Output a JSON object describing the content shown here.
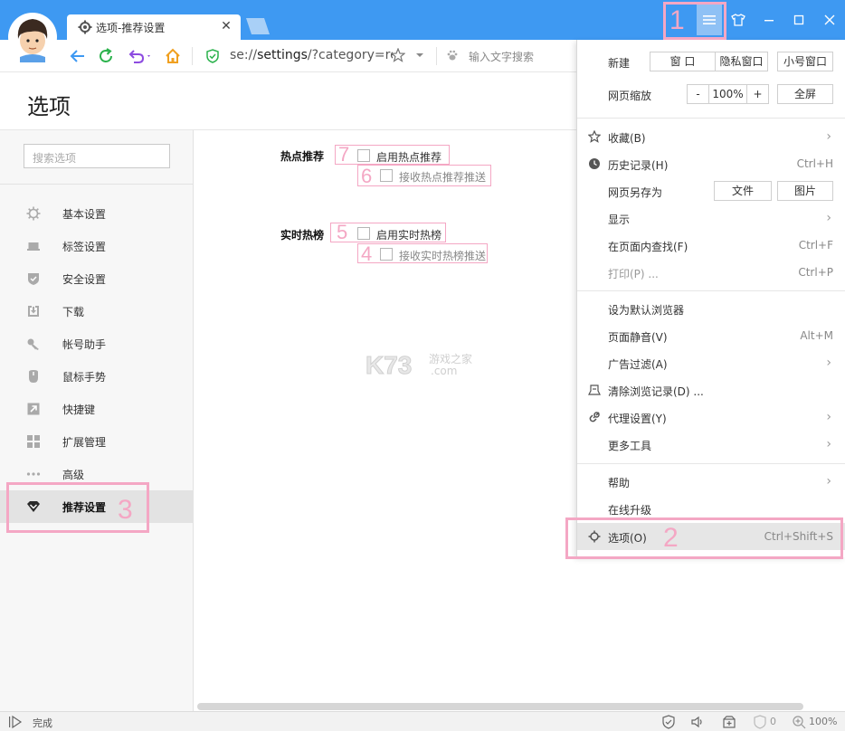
{
  "window": {
    "tab_title": "选项-推荐设置",
    "tab_close": "✕"
  },
  "address_bar": {
    "url_prefix": "se://",
    "url_host": "settings",
    "url_rest": "/?category=re",
    "search_placeholder": "输入文字搜索"
  },
  "options_page": {
    "title": "选项",
    "search_placeholder": "搜索选项"
  },
  "sidebar": {
    "items": [
      {
        "label": "基本设置",
        "icon": "gear-icon"
      },
      {
        "label": "标签设置",
        "icon": "tab-icon"
      },
      {
        "label": "安全设置",
        "icon": "shield-icon"
      },
      {
        "label": "下载",
        "icon": "download-icon"
      },
      {
        "label": "帐号助手",
        "icon": "key-icon"
      },
      {
        "label": "鼠标手势",
        "icon": "mouse-icon"
      },
      {
        "label": "快捷键",
        "icon": "shortcut-icon"
      },
      {
        "label": "扩展管理",
        "icon": "extensions-icon"
      },
      {
        "label": "高级",
        "icon": "more-dots-icon"
      },
      {
        "label": "推荐设置",
        "icon": "diamond-icon",
        "active": true
      }
    ]
  },
  "content": {
    "hot_section_label": "热点推荐",
    "hot_enable_label": "启用热点推荐",
    "hot_push_label": "接收热点推荐推送",
    "realtime_section_label": "实时热榜",
    "realtime_enable_label": "启用实时热榜",
    "realtime_push_label": "接收实时热榜推送",
    "watermark_main": "K73",
    "watermark_sub": "游戏之家",
    "watermark_domain": ".com"
  },
  "annotations": {
    "n1": "1",
    "n2": "2",
    "n3": "3",
    "n4": "4",
    "n5": "5",
    "n6": "6",
    "n7": "7"
  },
  "menu": {
    "new_label": "新建",
    "new_window": "窗 口",
    "new_private": "隐私窗口",
    "new_small": "小号窗口",
    "zoom_label": "网页缩放",
    "zoom_minus": "-",
    "zoom_value": "100%",
    "zoom_plus": "+",
    "fullscreen": "全屏",
    "favorites": "收藏(B)",
    "history": "历史记录(H)",
    "history_sc": "Ctrl+H",
    "save_as": "网页另存为",
    "save_file": "文件",
    "save_image": "图片",
    "display": "显示",
    "find": "在页面内查找(F)",
    "find_sc": "Ctrl+F",
    "print": "打印(P) ...",
    "print_sc": "Ctrl+P",
    "set_default": "设为默认浏览器",
    "mute": "页面静音(V)",
    "mute_sc": "Alt+M",
    "adblock": "广告过滤(A)",
    "clear": "清除浏览记录(D) ...",
    "proxy": "代理设置(Y)",
    "more_tools": "更多工具",
    "help": "帮助",
    "upgrade": "在线升级",
    "options": "选项(O)",
    "options_sc": "Ctrl+Shift+S"
  },
  "status": {
    "text": "完成",
    "zoom": "100%",
    "zero": "0"
  }
}
